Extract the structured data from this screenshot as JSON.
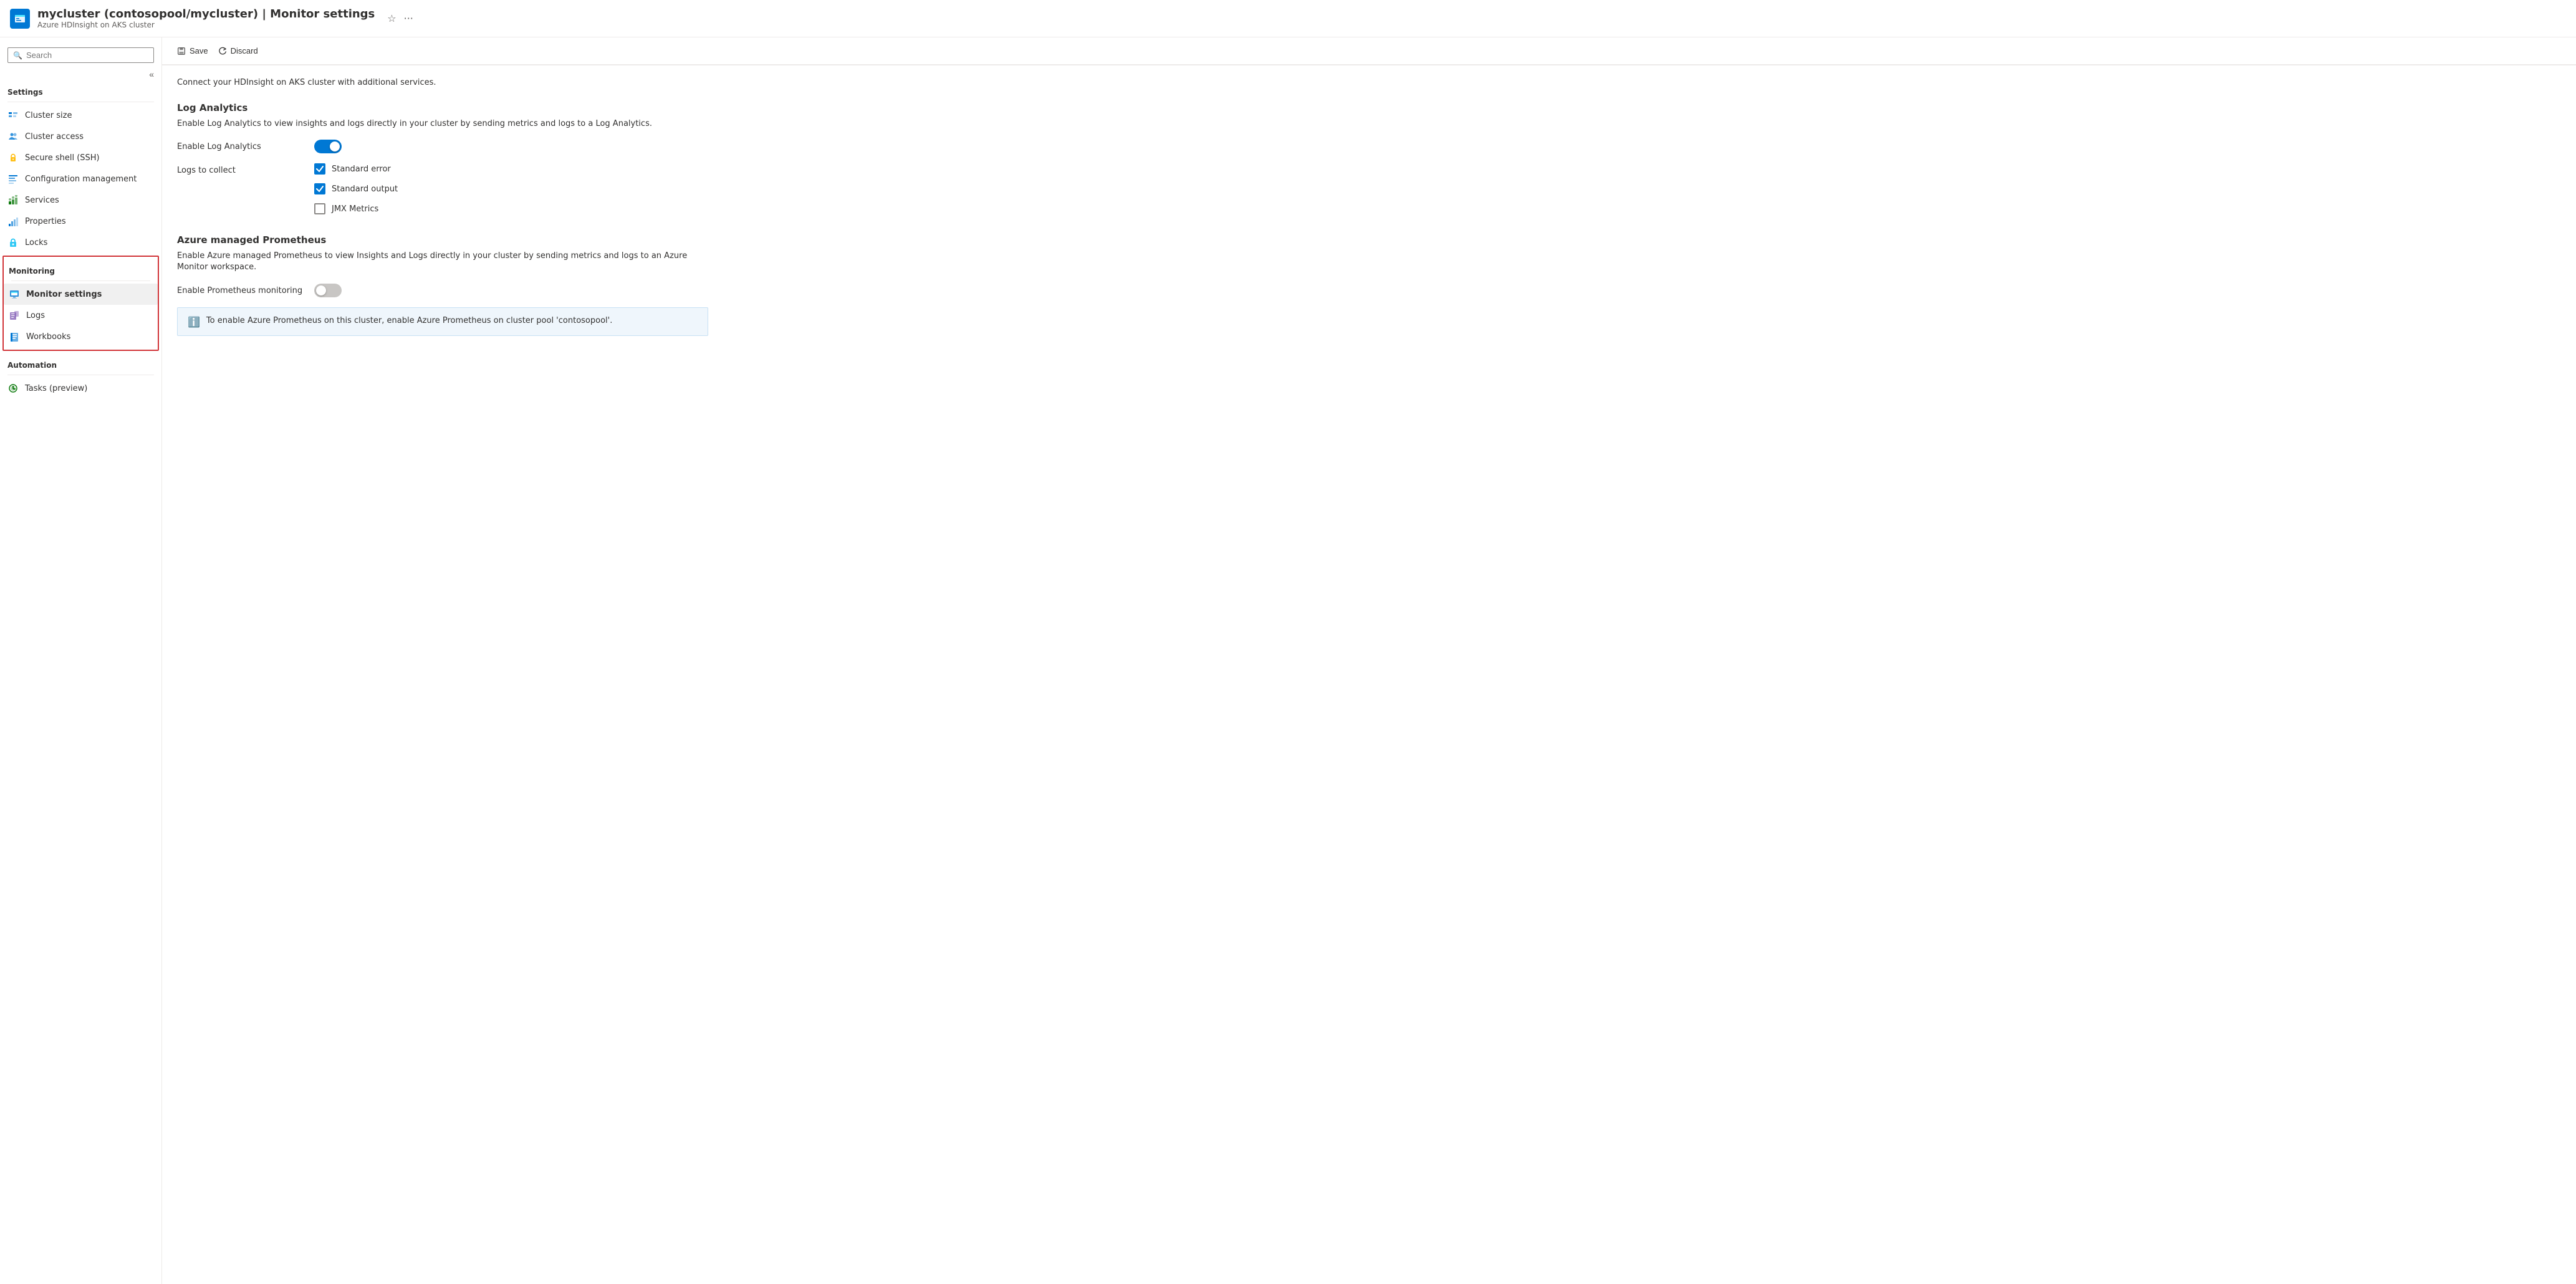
{
  "header": {
    "title": "mycluster (contosopool/mycluster) | Monitor settings",
    "subtitle": "Azure HDInsight on AKS cluster",
    "star_icon": "☆",
    "ellipsis_icon": "···"
  },
  "sidebar": {
    "search_placeholder": "Search",
    "collapse_icon": "«",
    "sections": [
      {
        "label": "Settings",
        "items": [
          {
            "id": "cluster-size",
            "label": "Cluster size",
            "icon": "📋"
          },
          {
            "id": "cluster-access",
            "label": "Cluster access",
            "icon": "👥"
          },
          {
            "id": "secure-shell",
            "label": "Secure shell (SSH)",
            "icon": "🔑"
          },
          {
            "id": "configuration-management",
            "label": "Configuration management",
            "icon": "📊"
          },
          {
            "id": "services",
            "label": "Services",
            "icon": "🏗️"
          },
          {
            "id": "properties",
            "label": "Properties",
            "icon": "📉"
          },
          {
            "id": "locks",
            "label": "Locks",
            "icon": "🔒"
          }
        ]
      },
      {
        "label": "Monitoring",
        "is_monitoring": true,
        "items": [
          {
            "id": "monitor-settings",
            "label": "Monitor settings",
            "icon": "📋",
            "active": true
          },
          {
            "id": "logs",
            "label": "Logs",
            "icon": "📊"
          },
          {
            "id": "workbooks",
            "label": "Workbooks",
            "icon": "📘"
          }
        ]
      },
      {
        "label": "Automation",
        "items": [
          {
            "id": "tasks-preview",
            "label": "Tasks (preview)",
            "icon": "⚙️"
          }
        ]
      }
    ]
  },
  "toolbar": {
    "save_label": "Save",
    "discard_label": "Discard"
  },
  "content": {
    "page_description": "Connect your HDInsight on AKS cluster with additional services.",
    "sections": [
      {
        "id": "log-analytics",
        "title": "Log Analytics",
        "description": "Enable Log Analytics to view insights and logs directly in your cluster by sending metrics and logs to a Log Analytics.",
        "fields": [
          {
            "id": "enable-log-analytics",
            "label": "Enable Log Analytics",
            "type": "toggle",
            "value": true
          },
          {
            "id": "logs-to-collect",
            "label": "Logs to collect",
            "type": "checkboxes",
            "options": [
              {
                "id": "standard-error",
                "label": "Standard error",
                "checked": true
              },
              {
                "id": "standard-output",
                "label": "Standard output",
                "checked": true
              },
              {
                "id": "jmx-metrics",
                "label": "JMX Metrics",
                "checked": false
              }
            ]
          }
        ]
      },
      {
        "id": "azure-prometheus",
        "title": "Azure managed Prometheus",
        "description": "Enable Azure managed Prometheus to view Insights and Logs directly in your cluster by sending metrics and logs to an Azure Monitor workspace.",
        "fields": [
          {
            "id": "enable-prometheus",
            "label": "Enable Prometheus monitoring",
            "type": "toggle",
            "value": false
          }
        ],
        "info_banner": {
          "text": "To enable Azure Prometheus on this cluster, enable Azure Prometheus on cluster pool 'contosopool'."
        }
      }
    ]
  }
}
